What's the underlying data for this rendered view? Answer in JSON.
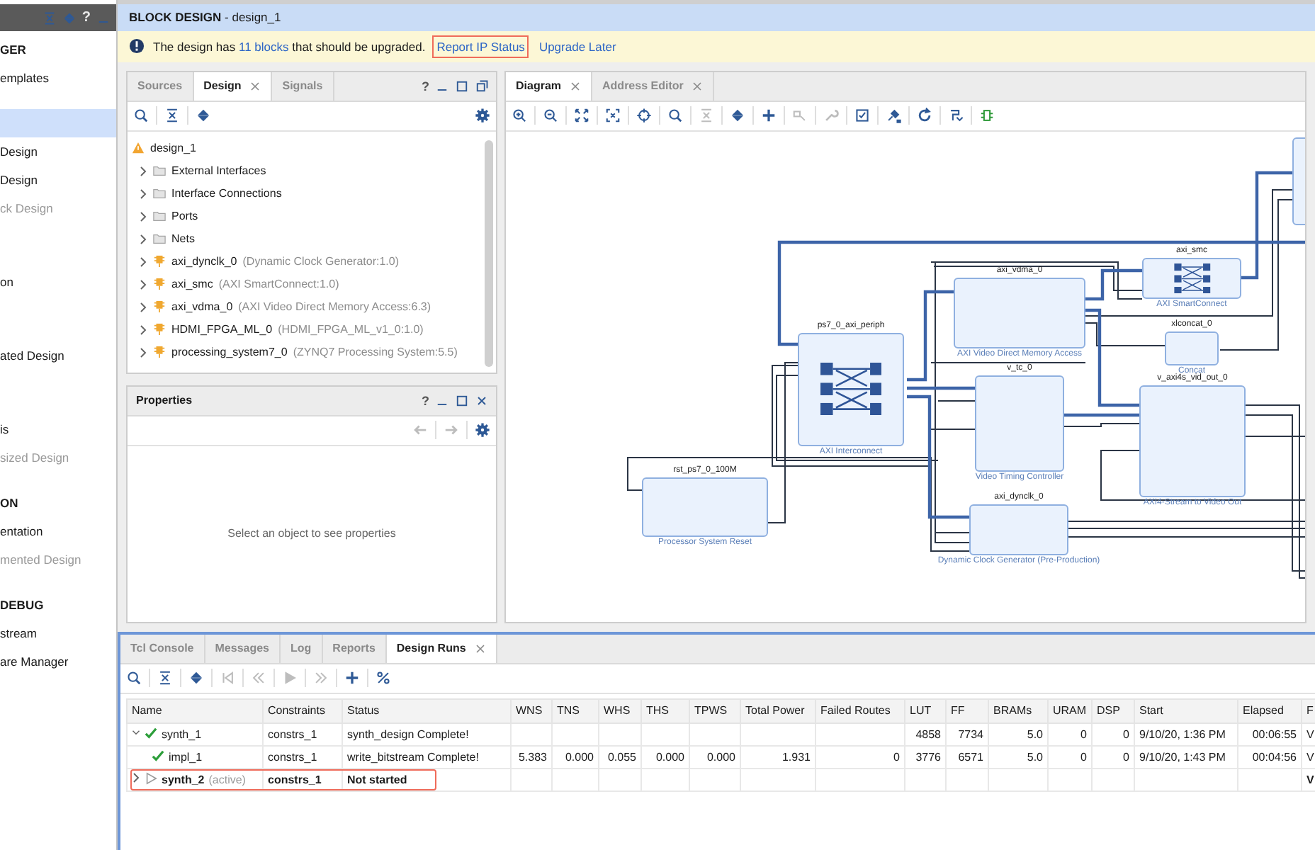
{
  "navigator": {
    "controls": [
      {
        "kind": "collapse"
      },
      {
        "kind": "expand"
      },
      {
        "kind": "help",
        "text": "?"
      },
      {
        "kind": "minimize"
      }
    ],
    "sections": [
      {
        "title": "GER",
        "selected": false,
        "items": [
          {
            "label": "emplates",
            "selected": false,
            "disabled": false
          }
        ]
      },
      {
        "selected": true,
        "items": [
          {
            "label": "Design",
            "selected": false,
            "disabled": false
          },
          {
            "label": "Design",
            "selected": false,
            "disabled": false
          },
          {
            "label": "ck Design",
            "selected": false,
            "disabled": true
          }
        ]
      },
      {
        "items": [
          {
            "label": "on",
            "selected": false,
            "disabled": false
          }
        ]
      },
      {
        "items": [
          {
            "label": "ated Design",
            "selected": false,
            "disabled": false
          }
        ]
      },
      {
        "items": [
          {
            "label": "is",
            "selected": false,
            "disabled": false
          },
          {
            "label": "sized Design",
            "selected": false,
            "disabled": true
          }
        ]
      },
      {
        "title": "ON",
        "selected": false,
        "items": [
          {
            "label": "entation",
            "selected": false,
            "disabled": false
          },
          {
            "label": "mented Design",
            "selected": false,
            "disabled": true
          }
        ]
      },
      {
        "title": "DEBUG",
        "selected": false,
        "items": [
          {
            "label": "stream",
            "selected": false,
            "disabled": false
          },
          {
            "label": "are Manager",
            "selected": false,
            "disabled": false
          }
        ]
      }
    ]
  },
  "title": "**BLOCK DESIGN** - design_1",
  "banner": {
    "before": "The design has",
    "link": "11 blocks",
    "after": "that should be upgraded.",
    "actions": [
      {
        "label": "Report IP Status",
        "highlighted": true
      },
      {
        "label": "Upgrade Later",
        "highlighted": false
      }
    ]
  },
  "sources_panel": {
    "tabs": [
      {
        "label": "Sources",
        "selected": false,
        "closable": false
      },
      {
        "label": "Design",
        "selected": true,
        "closable": true
      },
      {
        "label": "Signals",
        "selected": false,
        "closable": false
      }
    ],
    "controls": [
      {
        "kind": "help",
        "text": "?"
      },
      {
        "kind": "minimize"
      },
      {
        "kind": "maximize"
      },
      {
        "kind": "restore"
      }
    ],
    "toolbar": {
      "left": [
        {
          "kind": "search",
          "disabled": false
        },
        {
          "kind": "collapse",
          "disabled": false
        },
        {
          "kind": "expand",
          "disabled": false
        }
      ],
      "right": [
        {
          "kind": "gear",
          "disabled": false
        }
      ]
    },
    "tree": {
      "label": "design_1",
      "warning": true,
      "children": [
        {
          "kind": "folder",
          "label": "External Interfaces",
          "expanded": false
        },
        {
          "kind": "folder",
          "label": "Interface Connections",
          "expanded": false
        },
        {
          "kind": "folder",
          "label": "Ports",
          "expanded": false
        },
        {
          "kind": "folder",
          "label": "Nets",
          "expanded": false
        },
        {
          "kind": "ip",
          "label": "axi_dynclk_0",
          "detail": "(Dynamic Clock Generator:1.0)",
          "expanded": false
        },
        {
          "kind": "ip",
          "label": "axi_smc",
          "detail": "(AXI SmartConnect:1.0)",
          "expanded": false
        },
        {
          "kind": "ip",
          "label": "axi_vdma_0",
          "detail": "(AXI Video Direct Memory Access:6.3)",
          "expanded": false
        },
        {
          "kind": "ip",
          "label": "HDMI_FPGA_ML_0",
          "detail": "(HDMI_FPGA_ML_v1_0:1.0)",
          "expanded": false
        },
        {
          "kind": "ip",
          "label": "processing_system7_0",
          "detail": "(ZYNQ7 Processing System:5.5)",
          "expanded": false
        }
      ]
    }
  },
  "properties_panel": {
    "title": "Properties",
    "controls": [
      {
        "kind": "help",
        "text": "?"
      },
      {
        "kind": "minimize"
      },
      {
        "kind": "maximize"
      },
      {
        "kind": "close"
      }
    ],
    "toolbar": {
      "right": [
        {
          "kind": "back",
          "disabled": true
        },
        {
          "kind": "forward",
          "disabled": true
        },
        {
          "kind": "gear",
          "disabled": false
        }
      ]
    },
    "empty_text": "Select an object to see properties"
  },
  "diagram_panel": {
    "tabs": [
      {
        "label": "Diagram",
        "selected": true,
        "closable": true
      },
      {
        "label": "Address Editor",
        "selected": false,
        "closable": true
      }
    ],
    "toolbar": {
      "left": [
        {
          "kind": "zoom-in",
          "disabled": false
        },
        {
          "kind": "zoom-out",
          "disabled": false
        },
        {
          "kind": "fit",
          "disabled": false
        },
        {
          "kind": "fit-selection",
          "disabled": false
        },
        {
          "kind": "crosshair",
          "disabled": false
        },
        {
          "kind": "search",
          "disabled": false
        },
        {
          "kind": "collapse",
          "disabled": true
        },
        {
          "kind": "expand",
          "disabled": false
        },
        {
          "kind": "plus",
          "disabled": false
        },
        {
          "kind": "port",
          "disabled": true
        },
        {
          "kind": "wrench",
          "disabled": true
        },
        {
          "kind": "checkbox",
          "disabled": false
        },
        {
          "kind": "pin",
          "disabled": false
        },
        {
          "kind": "refresh",
          "disabled": false
        },
        {
          "kind": "route",
          "disabled": false
        },
        {
          "kind": "chip",
          "disabled": false
        }
      ]
    },
    "blocks": [
      {
        "name": "rst_ps7_0_100M",
        "title": "Processor System Reset",
        "kind": "plain"
      },
      {
        "name": "ps7_0_axi_periph",
        "title": "AXI Interconnect",
        "kind": "crossbar"
      },
      {
        "name": "axi_vdma_0",
        "title": "AXI Video Direct Memory Access",
        "kind": "plain"
      },
      {
        "name": "v_tc_0",
        "title": "Video Timing Controller",
        "kind": "plain"
      },
      {
        "name": "axi_dynclk_0",
        "title": "Dynamic Clock Generator (Pre-Production)",
        "kind": "plain"
      },
      {
        "name": "axi_smc",
        "title": "AXI SmartConnect",
        "kind": "crossbar"
      },
      {
        "name": "xlconcat_0",
        "title": "Concat",
        "kind": "plain"
      },
      {
        "name": "v_axi4s_vid_out_0",
        "title": "AXI4-Stream to Video Out",
        "kind": "plain"
      },
      {
        "kind": "plain"
      }
    ]
  },
  "runs_panel": {
    "tabs": [
      {
        "label": "Tcl Console",
        "selected": false,
        "closable": false
      },
      {
        "label": "Messages",
        "selected": false,
        "closable": false
      },
      {
        "label": "Log",
        "selected": false,
        "closable": false
      },
      {
        "label": "Reports",
        "selected": false,
        "closable": false
      },
      {
        "label": "Design Runs",
        "selected": true,
        "closable": true
      }
    ],
    "toolbar": {
      "left": [
        {
          "kind": "search",
          "disabled": false
        },
        {
          "kind": "collapse",
          "disabled": false
        },
        {
          "kind": "expand",
          "disabled": false
        },
        {
          "kind": "first",
          "disabled": true
        },
        {
          "kind": "previous",
          "disabled": true
        },
        {
          "kind": "play",
          "disabled": true
        },
        {
          "kind": "next",
          "disabled": true
        },
        {
          "kind": "plus",
          "disabled": false
        },
        {
          "kind": "percent",
          "disabled": false
        }
      ]
    },
    "columns": [
      {
        "label": "Name"
      },
      {
        "label": "Constraints"
      },
      {
        "label": "Status"
      },
      {
        "label": "WNS"
      },
      {
        "label": "TNS"
      },
      {
        "label": "WHS"
      },
      {
        "label": "THS"
      },
      {
        "label": "TPWS"
      },
      {
        "label": "Total Power"
      },
      {
        "label": "Failed Routes"
      },
      {
        "label": "LUT"
      },
      {
        "label": "FF"
      },
      {
        "label": "BRAMs"
      },
      {
        "label": "URAM"
      },
      {
        "label": "DSP"
      },
      {
        "label": "Start"
      },
      {
        "label": "Elapsed"
      },
      {
        "label": "F"
      }
    ],
    "rows": [
      {
        "kind": "complete",
        "active": false,
        "highlighted": false,
        "expanded": true,
        "cells": [
          "synth_1",
          "constrs_1",
          "synth_design Complete!",
          null,
          null,
          null,
          null,
          null,
          null,
          null,
          "4858",
          "7734",
          "5.0",
          "0",
          "0",
          "9/10/20, 1:36 PM",
          "00:06:55",
          "V"
        ],
        "children": [
          {
            "kind": "complete",
            "active": false,
            "highlighted": false,
            "cells": [
              "impl_1",
              "constrs_1",
              "write_bitstream Complete!",
              "5.383",
              "0.000",
              "0.055",
              "0.000",
              "0.000",
              "1.931",
              "0",
              "3776",
              "6571",
              "5.0",
              "0",
              "0",
              "9/10/20, 1:43 PM",
              "00:04:56",
              "V"
            ]
          }
        ]
      },
      {
        "note": "(active)",
        "kind": "not_started",
        "active": true,
        "highlighted": true,
        "expanded": false,
        "cells": [
          "synth_2",
          "constrs_1",
          "Not started",
          null,
          null,
          null,
          null,
          null,
          null,
          null,
          null,
          null,
          null,
          null,
          null,
          null,
          null,
          "V"
        ]
      }
    ]
  }
}
